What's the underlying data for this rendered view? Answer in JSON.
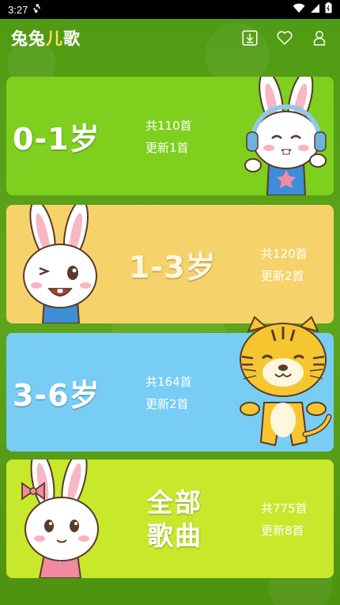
{
  "status_bar": {
    "time": "3:27"
  },
  "app_bar": {
    "title_part1": "兔兔",
    "title_part2": "儿",
    "title_part3": "歌",
    "actions": [
      {
        "icon": "download-icon"
      },
      {
        "icon": "heart-icon"
      },
      {
        "icon": "user-icon"
      }
    ]
  },
  "categories": [
    {
      "age": "0-1岁",
      "total": "共110首",
      "updated": "更新1首",
      "color": "#7fcf1f"
    },
    {
      "age": "1-3岁",
      "total": "共120首",
      "updated": "更新2首",
      "color": "#f5d36a"
    },
    {
      "age": "3-6岁",
      "total": "共164首",
      "updated": "更新2首",
      "color": "#77cdf4"
    },
    {
      "age_line1": "全部",
      "age_line2": "歌曲",
      "total": "共775首",
      "updated": "更新8首",
      "color": "#c7e82b"
    }
  ]
}
